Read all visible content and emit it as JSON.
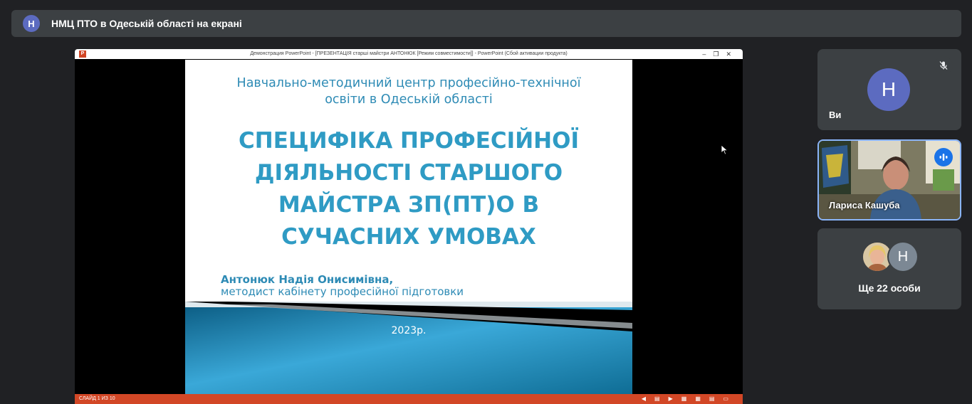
{
  "topbar": {
    "avatar_letter": "Н",
    "presenter_text": "НМЦ ПТО в Одеській області на екрані"
  },
  "ppt_window": {
    "title": "Демонстрация PowerPoint - [ПРЕЗЕНТАЦІЯ старші майстри АНТОНЮК [Режим совместимости]] - PowerPoint (Сбой активации продукта)",
    "status_slide": "СЛАЙД 1 ИЗ 10"
  },
  "slide": {
    "subtitle_line1": "Навчально-методичний центр професійно-технічної",
    "subtitle_line2": "освіти в Одеській області",
    "title_line1": "СПЕЦИФІКА ПРОФЕСІЙНОЇ",
    "title_line2": "ДІЯЛЬНОСТІ СТАРШОГО",
    "title_line3": "МАЙСТРА ЗП(ПТ)О В",
    "title_line4": "СУЧАСНИХ УМОВАХ",
    "author_name": "Антонюк Надія Онисимівна,",
    "author_role": "методист кабінету професійної підготовки",
    "year": "2023р."
  },
  "participants": {
    "you": {
      "avatar_letter": "Н",
      "name": "Ви"
    },
    "speaker": {
      "name": "Лариса Кашуба"
    },
    "more": {
      "avatar_letter": "Н",
      "label": "Ще 22 особи"
    }
  },
  "colors": {
    "background": "#202124",
    "tile": "#3c4043",
    "avatar": "#5c6bc0",
    "active_border": "#8ab4f8",
    "slide_text": "#2f9bc4",
    "ppt_status": "#d24726"
  },
  "icons": [
    "mic-off-icon",
    "speaking-indicator-icon",
    "powerpoint-icon",
    "mouse-cursor-icon"
  ]
}
